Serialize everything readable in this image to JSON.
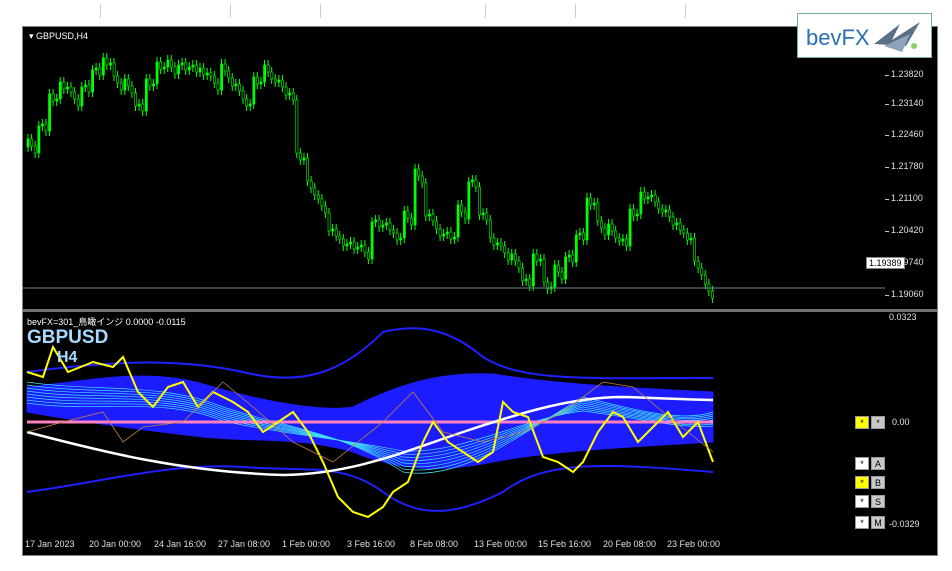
{
  "symbol_title": "GBPUSD,H4",
  "indicator_title": "bevFX=301_鳥瞰インジ 0.0000 -0.0115",
  "big_symbol": "GBPUSD",
  "big_timeframe": "H4",
  "logo_text": "bevFX",
  "current_price": "1.19389",
  "price_axis": [
    "1.23820",
    "1.23140",
    "1.22460",
    "1.21780",
    "1.21100",
    "1.20420",
    "1.19740",
    "1.19060"
  ],
  "indicator_axis": {
    "top": "0.0323",
    "zero": "0.00",
    "bottom": "-0.0329"
  },
  "time_axis": [
    "17 Jan 2023",
    "20 Jan 00:00",
    "24 Jan 16:00",
    "27 Jan 08:00",
    "1 Feb 00:00",
    "3 Feb 16:00",
    "8 Feb 08:00",
    "13 Feb 00:00",
    "15 Feb 16:00",
    "20 Feb 08:00",
    "23 Feb 00:00"
  ],
  "side_buttons": {
    "star": "*",
    "a": "A",
    "b": "B",
    "s": "S",
    "m": "M"
  },
  "colors": {
    "candles": "#00ff00",
    "bands": "#1c1cff",
    "oscillator": "#ffff00",
    "zero_line": "#ff80c0",
    "ma_line": "#ffffff",
    "ribbon": "#40e0ff"
  }
}
